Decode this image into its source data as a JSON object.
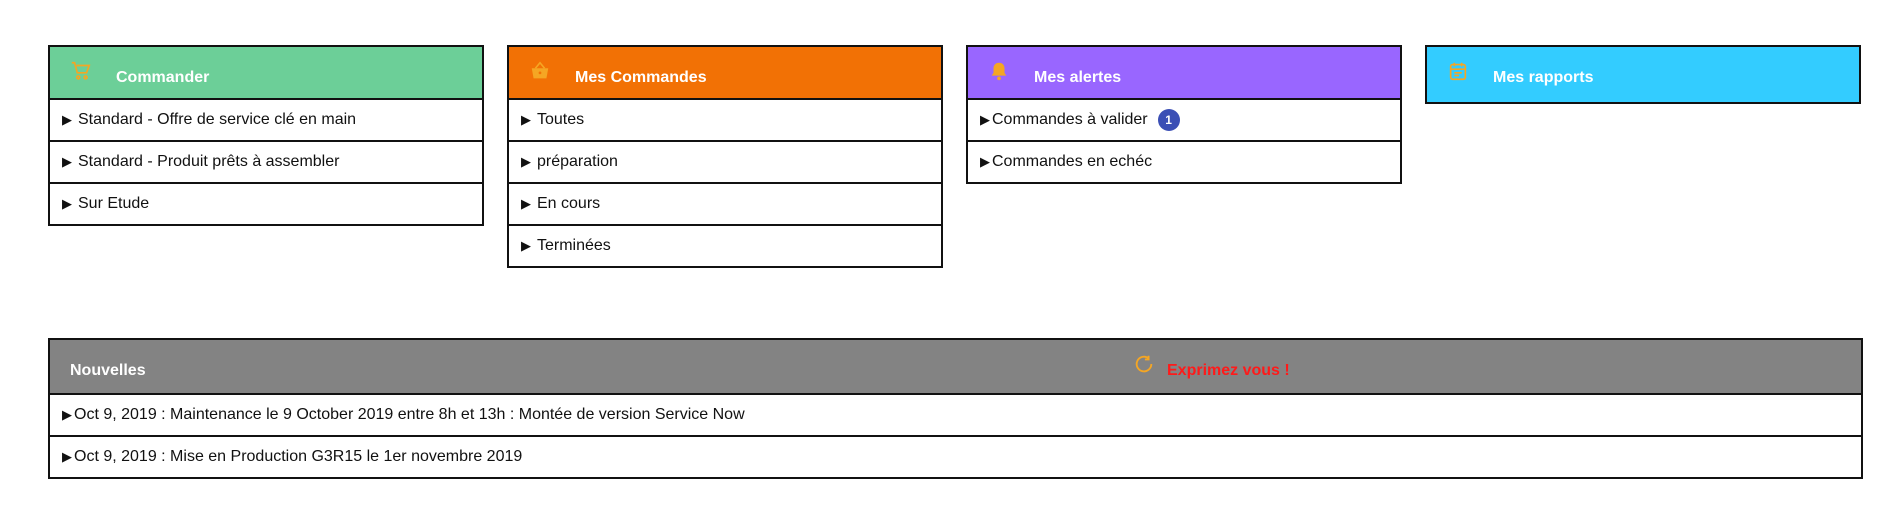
{
  "colors": {
    "commander": "#6ccf98",
    "mes_commandes": "#f27105",
    "mes_alertes": "#9966ff",
    "mes_rapports": "#33ccff",
    "nouvelles": "#838383",
    "icon": "#f5a623",
    "exprimez": "#ff1a1a",
    "badge": "#3b4fb5"
  },
  "cards": {
    "commander": {
      "icon": "cart-icon",
      "title": "Commander",
      "items": [
        "Standard - Offre de service clé en main",
        "Standard - Produit prêts à assembler",
        "Sur Etude"
      ]
    },
    "mes_commandes": {
      "icon": "basket-icon",
      "title": "Mes Commandes",
      "items": [
        "Toutes",
        "préparation",
        "En cours",
        "Terminées"
      ]
    },
    "mes_alertes": {
      "icon": "bell-icon",
      "title": "Mes alertes",
      "items": [
        {
          "label": "Commandes à valider",
          "badge": "1"
        },
        {
          "label": "Commandes en echéc"
        }
      ]
    },
    "mes_rapports": {
      "icon": "calendar-icon",
      "title": "Mes rapports"
    }
  },
  "arrow": "▶",
  "nouvelles": {
    "title": "Nouvelles",
    "exprimez_icon": "refresh-icon",
    "exprimez_label": "Exprimez vous !",
    "items": [
      "Oct 9, 2019 : Maintenance le 9 October 2019 entre 8h et 13h : Montée de version Service Now",
      "Oct 9, 2019 : Mise en Production G3R15 le 1er novembre 2019"
    ]
  }
}
